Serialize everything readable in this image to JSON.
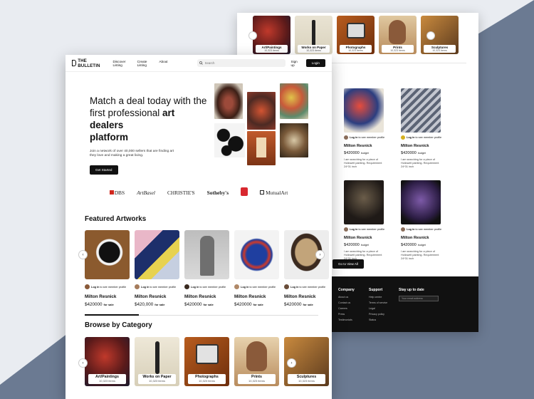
{
  "colors": {
    "accent": "#111111",
    "backdrop_dark": "#6b7a92",
    "backdrop_light": "#e9ecf1"
  },
  "nav": {
    "logo": "THE BULLETIN",
    "links": [
      "Discover Listing",
      "Create Listing",
      "About"
    ],
    "search_placeholder": "Search",
    "signup": "Sign up",
    "login": "Login"
  },
  "hero": {
    "line1": "Match a deal today with the",
    "line2_pre": "first professional ",
    "line2_bold": "art dealers",
    "line3_bold": "platform",
    "body": "Join a network of over 40,000 sellers that are finding art they love and making a great living.",
    "cta": "Get Started"
  },
  "brands": [
    "DBS",
    "ArtBasel",
    "CHRISTIE'S",
    "Sotheby's",
    "MutualArt"
  ],
  "featured": {
    "title": "Featured Artworks",
    "cards": [
      {
        "login": "Log in",
        "login_rest": " to see member profile",
        "name": "Milton Resnick",
        "price": "$420000",
        "tag": "for sale"
      },
      {
        "login": "Log in",
        "login_rest": " to see member profile",
        "name": "Milton Resnick",
        "price": "$420,000",
        "tag": "for sale"
      },
      {
        "login": "Log in",
        "login_rest": " to see member profile",
        "name": "Milton Resnick",
        "price": "$420000",
        "tag": "for sale"
      },
      {
        "login": "Log in",
        "login_rest": " to see member profile",
        "name": "Milton Resnick",
        "price": "$420000",
        "tag": "for sale"
      },
      {
        "login": "Log in",
        "login_rest": " to see member profile",
        "name": "Milton Resnick",
        "price": "$420000",
        "tag": "for sale"
      }
    ]
  },
  "categories": {
    "title": "Browse by Category",
    "items": [
      {
        "name": "Art/Paintings",
        "count": "10,323 items"
      },
      {
        "name": "Works on Paper",
        "count": "10,323 items"
      },
      {
        "name": "Photographs",
        "count": "10,323 items"
      },
      {
        "name": "Prints",
        "count": "10,323 items"
      },
      {
        "name": "Sculptures",
        "count": "10,323 items"
      }
    ]
  },
  "back": {
    "categories": [
      {
        "name": "Art/Paintings",
        "count": "10,323 items"
      },
      {
        "name": "Works on Paper",
        "count": "10,323 items"
      },
      {
        "name": "Photographs",
        "count": "10,323 items"
      },
      {
        "name": "Prints",
        "count": "10,323 items"
      },
      {
        "name": "Sculptures",
        "count": "10,323 items"
      }
    ],
    "wanted": [
      {
        "login": "Log in",
        "login_rest": " to see member profile",
        "name": "Milton Resnick",
        "price": "$420000",
        "tag": "budget",
        "desc": "I am searching for a piece of Hollowell painting. Requirement 24*31 inch"
      },
      {
        "login": "Log in",
        "login_rest": " to see member profile",
        "name": "Milton Resnick",
        "price": "$420000",
        "tag": "budget",
        "desc": "I am searching for a piece of Hollowell painting. Requirement 24*31 inch"
      },
      {
        "login": "Log in",
        "login_rest": " to see member profile",
        "name": "Milton Resnick",
        "price": "$420000",
        "tag": "budget",
        "desc": "I am searching for a piece of Hollowell painting. Requirement 24*31 inch"
      },
      {
        "login": "Log in",
        "login_rest": " to see member profile",
        "name": "Milton Resnick",
        "price": "$420000",
        "tag": "budget",
        "desc": "I am searching for a piece of Hollowell painting. Requirement 24*31 inch"
      }
    ],
    "view_all": "Go to View All",
    "footer": {
      "company": {
        "title": "Company",
        "items": [
          "About us",
          "Contact us",
          "Careers",
          "Press",
          "Testimonials"
        ]
      },
      "support": {
        "title": "Support",
        "items": [
          "Help centre",
          "Terms of service",
          "Legal",
          "Privacy policy",
          "Status"
        ]
      },
      "newsletter": {
        "title": "Stay up to date",
        "placeholder": "Your email address"
      }
    }
  }
}
